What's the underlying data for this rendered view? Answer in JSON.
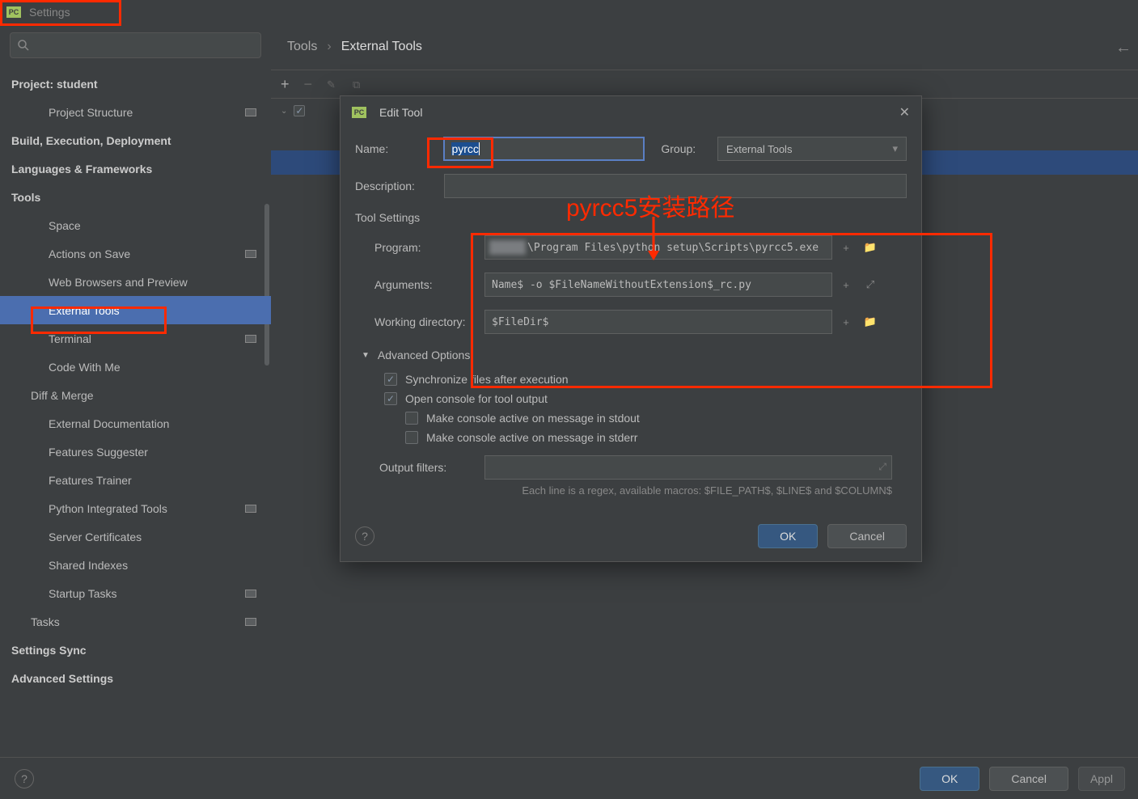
{
  "window": {
    "title": "Settings"
  },
  "search": {
    "placeholder": ""
  },
  "breadcrumb": {
    "root": "Tools",
    "current": "External Tools"
  },
  "sidebar": {
    "items": [
      {
        "label": "Project: student",
        "bold": true,
        "level": 0,
        "chevron": "",
        "flag": false
      },
      {
        "label": "Project Structure",
        "level": 2,
        "flag": true
      },
      {
        "label": "Build, Execution, Deployment",
        "bold": true,
        "level": 0,
        "chevron": "›",
        "flag": false
      },
      {
        "label": "Languages & Frameworks",
        "bold": true,
        "level": 0,
        "chevron": "›",
        "flag": false
      },
      {
        "label": "Tools",
        "bold": true,
        "level": 0,
        "chevron": "⌄",
        "flag": false
      },
      {
        "label": "Space",
        "level": 2,
        "flag": false
      },
      {
        "label": "Actions on Save",
        "level": 2,
        "flag": true
      },
      {
        "label": "Web Browsers and Preview",
        "level": 2,
        "flag": false
      },
      {
        "label": "External Tools",
        "level": 2,
        "flag": false,
        "selected": true
      },
      {
        "label": "Terminal",
        "level": 2,
        "flag": true
      },
      {
        "label": "Code With Me",
        "level": 2,
        "flag": false
      },
      {
        "label": "Diff & Merge",
        "level": 1,
        "chevron": "›",
        "flag": false
      },
      {
        "label": "External Documentation",
        "level": 2,
        "flag": false
      },
      {
        "label": "Features Suggester",
        "level": 2,
        "flag": false
      },
      {
        "label": "Features Trainer",
        "level": 2,
        "flag": false
      },
      {
        "label": "Python Integrated Tools",
        "level": 2,
        "flag": true
      },
      {
        "label": "Server Certificates",
        "level": 2,
        "flag": false
      },
      {
        "label": "Shared Indexes",
        "level": 2,
        "flag": false
      },
      {
        "label": "Startup Tasks",
        "level": 2,
        "flag": true
      },
      {
        "label": "Tasks",
        "level": 1,
        "chevron": "›",
        "flag": true
      },
      {
        "label": "Settings Sync",
        "bold": true,
        "level": 0,
        "flag": false
      },
      {
        "label": "Advanced Settings",
        "bold": true,
        "level": 0,
        "flag": false
      }
    ]
  },
  "dialog": {
    "title": "Edit Tool",
    "labels": {
      "name": "Name:",
      "group": "Group:",
      "description": "Description:",
      "tool_settings": "Tool Settings",
      "program": "Program:",
      "arguments": "Arguments:",
      "working_dir": "Working directory:",
      "advanced": "Advanced Options",
      "sync": "Synchronize files after execution",
      "open_console": "Open console for tool output",
      "stdout": "Make console active on message in stdout",
      "stderr": "Make console active on message in stderr",
      "output_filters": "Output filters:",
      "hint": "Each line is a regex, available macros: $FILE_PATH$, $LINE$ and $COLUMN$"
    },
    "values": {
      "name": "pyrcc",
      "group": "External Tools",
      "description": "",
      "program": "\\Program Files\\python setup\\Scripts\\pyrcc5.exe",
      "arguments": "Name$ -o $FileNameWithoutExtension$_rc.py",
      "working_dir": "$FileDir$",
      "sync_checked": true,
      "open_console_checked": true,
      "stdout_checked": false,
      "stderr_checked": false
    },
    "buttons": {
      "ok": "OK",
      "cancel": "Cancel"
    }
  },
  "bottom": {
    "ok": "OK",
    "cancel": "Cancel",
    "apply": "Appl"
  },
  "annotation": {
    "text": "pyrcc5安装路径"
  }
}
